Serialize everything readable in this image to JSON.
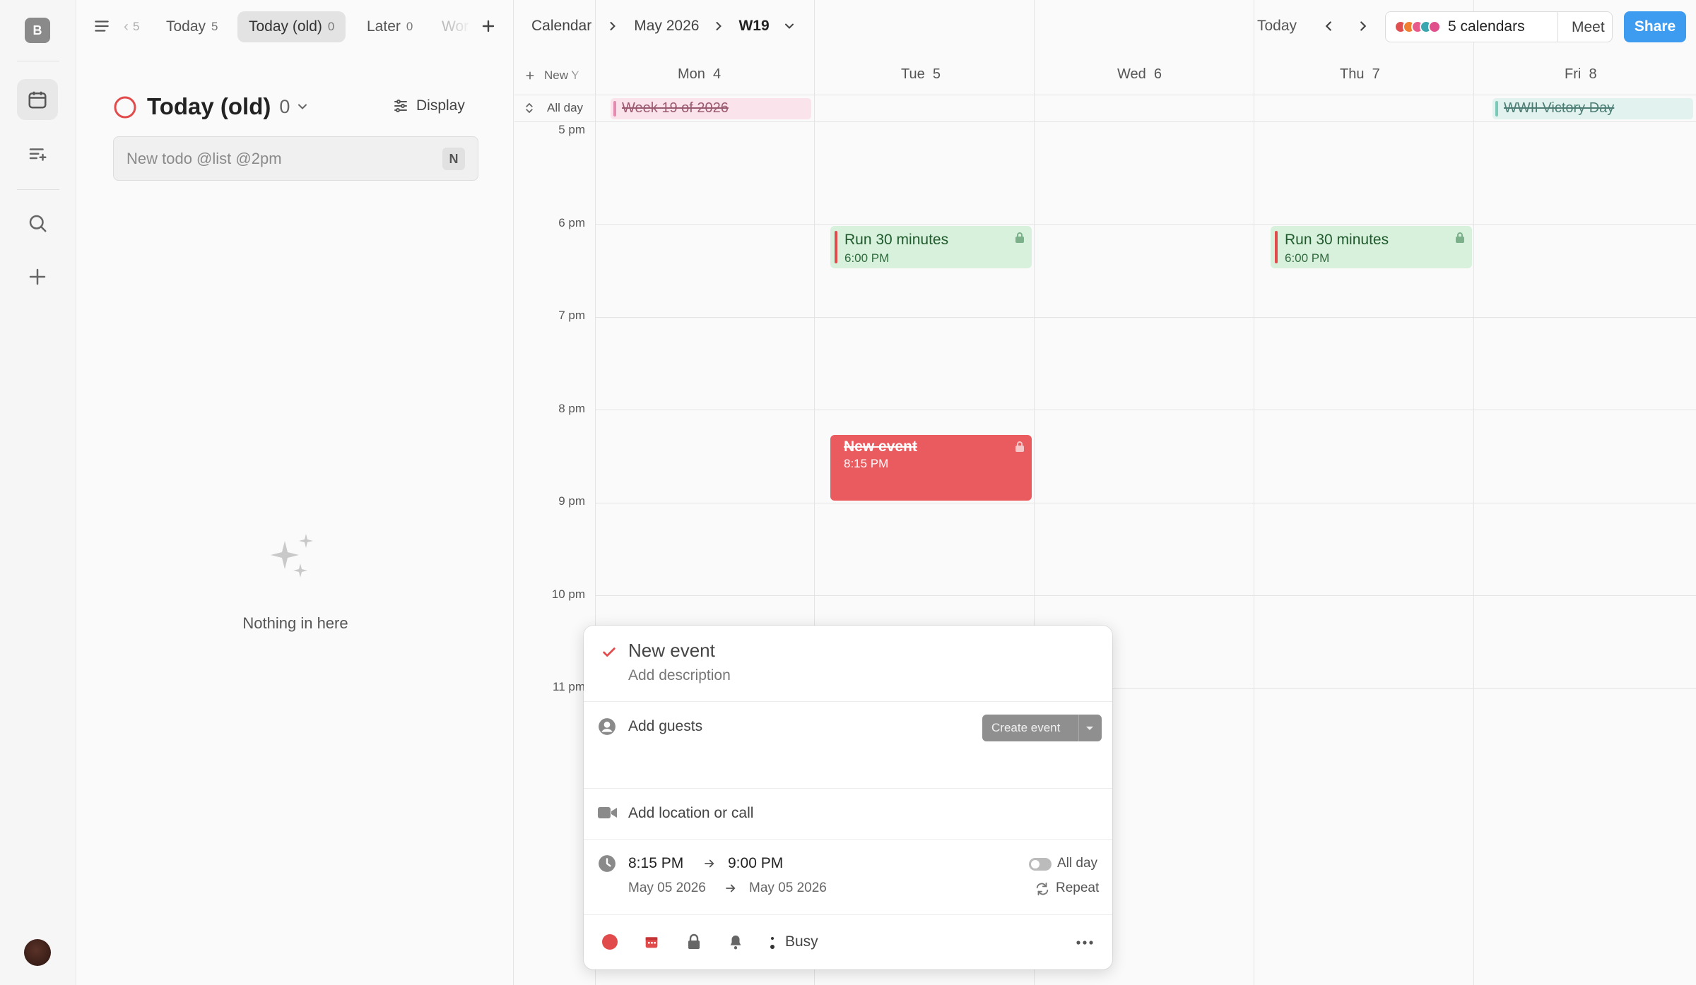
{
  "rail": {
    "avatar_letter": "B",
    "icons": [
      "calendar-icon",
      "todo-sparkle-icon",
      "search-icon",
      "plus-icon"
    ]
  },
  "tabs": {
    "items": [
      {
        "label": "‹",
        "count": "5"
      },
      {
        "label": "Today",
        "count": "5"
      },
      {
        "label": "Today (old)",
        "count": "0"
      },
      {
        "label": "Later",
        "count": "0"
      },
      {
        "label": "Wor",
        "count": ""
      }
    ]
  },
  "list": {
    "title": "Today (old)",
    "count": "0",
    "display_label": "Display",
    "new_todo_placeholder": "New todo @list @2pm",
    "shortcut": "N",
    "empty_text": "Nothing in here"
  },
  "calendar": {
    "breadcrumb": [
      "Calendar",
      "May 2026",
      "W19"
    ],
    "today_label": "Today",
    "calendars_label": "5 calendars",
    "calendar_colors": [
      "#e05050",
      "#f08030",
      "#e85a8a",
      "#3aa7b0",
      "#e0508a"
    ],
    "meet_label": "Meet",
    "share_label": "Share",
    "new_label": "New Y",
    "allday_label": "All day",
    "days": [
      {
        "name": "Mon",
        "num": "4"
      },
      {
        "name": "Tue",
        "num": "5"
      },
      {
        "name": "Wed",
        "num": "6"
      },
      {
        "name": "Thu",
        "num": "7"
      },
      {
        "name": "Fri",
        "num": "8"
      }
    ],
    "hours": [
      "5 pm",
      "6 pm",
      "7 pm",
      "8 pm",
      "9 pm",
      "10 pm",
      "11 pm"
    ],
    "allday_events": [
      {
        "title": "Week 19 of 2026",
        "day": "Mon"
      },
      {
        "title": "WWII Victory Day",
        "day": "Fri"
      }
    ],
    "events": [
      {
        "title": "Run 30 minutes",
        "time": "6:00 PM",
        "day": "Tue"
      },
      {
        "title": "Run 30 minutes",
        "time": "6:00 PM",
        "day": "Thu"
      },
      {
        "title": "New event",
        "time": "8:15 PM",
        "day": "Tue"
      }
    ]
  },
  "popover": {
    "title": "New event",
    "description_placeholder": "Add description",
    "guests_label": "Add guests",
    "create_label": "Create event",
    "location_label": "Add location or call",
    "start_time": "8:15 PM",
    "end_time": "9:00 PM",
    "start_date": "May 05 2026",
    "end_date": "May 05 2026",
    "allday_label": "All day",
    "repeat_label": "Repeat",
    "busy_label": "Busy",
    "colors": {
      "accent": "#e24b4b",
      "event": "#ea5b5f",
      "run": "#d8f1dc",
      "share": "#3d9bf0"
    }
  }
}
